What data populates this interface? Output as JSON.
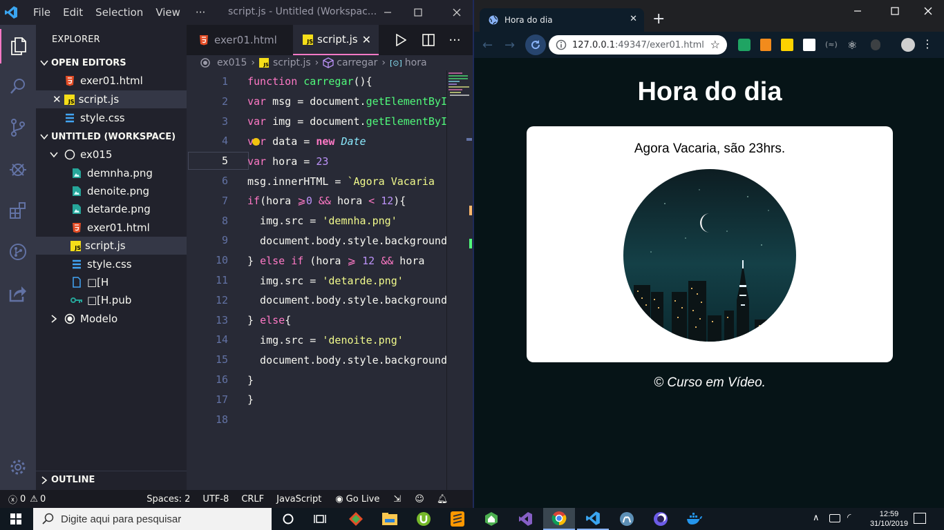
{
  "vscode": {
    "menu": [
      "File",
      "Edit",
      "Selection",
      "View",
      "···"
    ],
    "window_title": "script.js - Untitled (Workspac...",
    "explorer_title": "EXPLORER",
    "open_editors_title": "OPEN EDITORS",
    "open_editors": [
      "exer01.html",
      "script.js",
      "style.css"
    ],
    "workspace_title": "UNTITLED (WORKSPACE)",
    "tree": {
      "folder": "ex015",
      "files": [
        "demnha.png",
        "denoite.png",
        "detarde.png",
        "exer01.html",
        "script.js",
        "style.css",
        "□[H",
        "□[H.pub"
      ],
      "folder2": "Modelo"
    },
    "outline_title": "OUTLINE",
    "tabs": [
      "exer01.html",
      "script.js"
    ],
    "breadcrumb": [
      "ex015",
      "script.js",
      "carregar",
      "hora"
    ],
    "line_numbers": [
      "1",
      "2",
      "3",
      "4",
      "5",
      "6",
      "7",
      "8",
      "9",
      "10",
      "11",
      "12",
      "13",
      "14",
      "15",
      "16",
      "17",
      "18"
    ],
    "status": {
      "errors": "0",
      "warnings": "0",
      "spaces": "Spaces: 2",
      "encoding": "UTF-8",
      "eol": "CRLF",
      "language": "JavaScript",
      "golive": "Go Live"
    }
  },
  "browser": {
    "tab_title": "Hora do dia",
    "url_host": "127.0.0.1",
    "url_rest": ":49347/exer01.html",
    "page": {
      "heading": "Hora do dia",
      "message": "Agora Vacaria, são 23hrs.",
      "footer": "© Curso em Vídeo."
    }
  },
  "taskbar": {
    "search_placeholder": "Digite aqui para pesquisar",
    "time": "12:59",
    "date": "31/10/2019"
  },
  "colors": {
    "dracula_bg": "#282a36",
    "pink": "#ff79c6",
    "green": "#50fa7b",
    "yellow": "#f1fa8c",
    "purple": "#bd93f9",
    "page_bg": "#061417"
  }
}
